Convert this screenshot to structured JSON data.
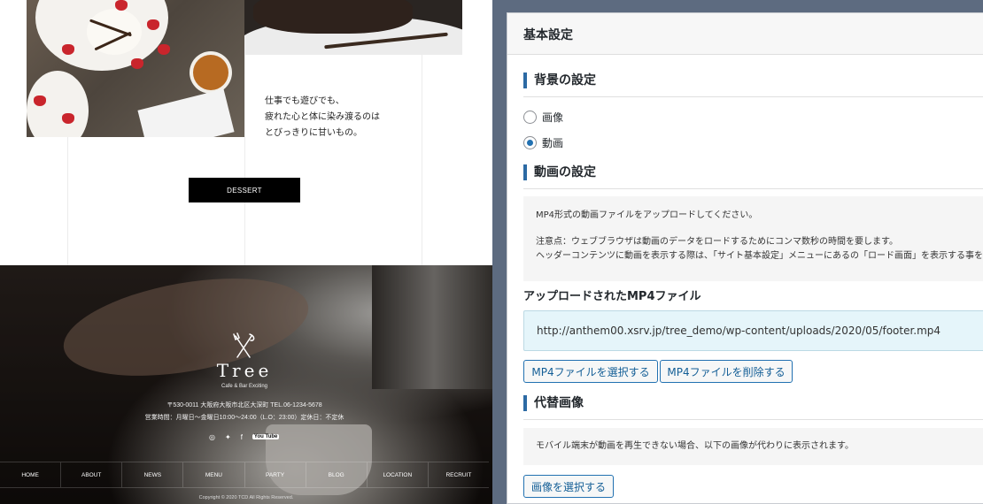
{
  "preview": {
    "tagline": [
      "仕事でも遊びでも、",
      "疲れた心と体に染み渡るのは",
      "とびっきりに甘いもの。"
    ],
    "dessert_button": "DESSERT",
    "footer": {
      "logo": "Tree",
      "logo_sub": "Cafe & Bar Exciting",
      "address": "〒530-0011 大阪府大阪市北区大深町 TEL.06-1234-5678",
      "hours": "営業時間：月曜日〜金曜日10:00〜24:00（L.O：23:00）定休日：不定休",
      "social": [
        "instagram-icon",
        "twitter-icon",
        "facebook-icon",
        "youtube-icon"
      ],
      "youtube_label": "You Tube",
      "nav": [
        "HOME",
        "ABOUT",
        "NEWS",
        "MENU",
        "PARTY",
        "BLOG",
        "LOCATION",
        "RECRUIT"
      ],
      "copyright": "Copyright © 2020 TCD All Rights Reserved."
    }
  },
  "panel": {
    "title": "基本設定",
    "background_section": {
      "title": "背景の設定",
      "options": [
        {
          "label": "画像",
          "selected": false
        },
        {
          "label": "動画",
          "selected": true
        }
      ]
    },
    "video_section": {
      "title": "動画の設定",
      "notes": [
        "MP4形式の動画ファイルをアップロードしてください。",
        "注意点：ウェブブラウザは動画のデータをロードするためにコンマ数秒の時間を要します。",
        "ヘッダーコンテンツに動画を表示する際は、「サイト基本設定」メニューにあるの「ロード画面」を表示する事をお"
      ],
      "uploaded_label": "アップロードされたMP4ファイル",
      "uploaded_url": "http://anthem00.xsrv.jp/tree_demo/wp-content/uploads/2020/05/footer.mp4",
      "select_button": "MP4ファイルを選択する",
      "delete_button": "MP4ファイルを削除する"
    },
    "fallback_section": {
      "title": "代替画像",
      "note": "モバイル端末が動画を再生できない場合、以下の画像が代わりに表示されます。",
      "select_button": "画像を選択する"
    }
  },
  "colors": {
    "accent": "#2c6aa4",
    "button_text": "#135e96",
    "url_box_bg": "#e5f5fa",
    "desktop_bg": "#5d6b80"
  }
}
